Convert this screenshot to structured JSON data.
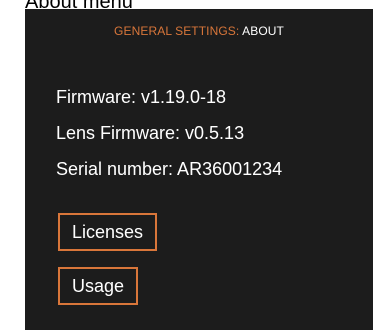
{
  "page_caption": "About menu",
  "header": {
    "section": "GENERAL SETTINGS:",
    "current": "ABOUT"
  },
  "info": {
    "firmware": "Firmware: v1.19.0-18",
    "lens_firmware": "Lens Firmware: v0.5.13",
    "serial_number": "Serial number: AR36001234"
  },
  "buttons": {
    "licenses": "Licenses",
    "usage": "Usage"
  },
  "colors": {
    "accent": "#d9763a",
    "panel_background": "#1c1c1c",
    "text": "#ffffff"
  }
}
